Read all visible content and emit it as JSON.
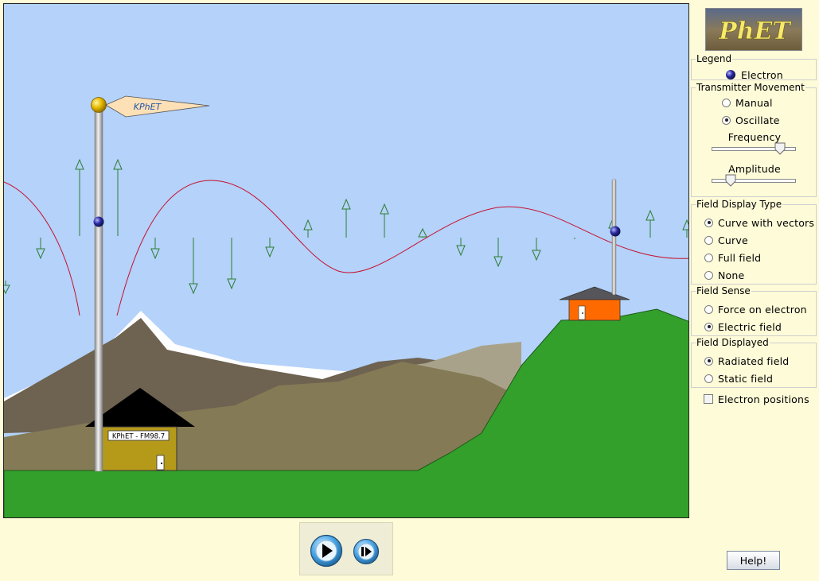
{
  "logo": {
    "text": "PhET"
  },
  "flag": {
    "text": "KPhET"
  },
  "station_sign": "KPhET - FM98.7",
  "legend": {
    "title": "Legend",
    "electron_label": "Electron"
  },
  "transmitter_movement": {
    "title": "Transmitter Movement",
    "options": [
      "Manual",
      "Oscillate"
    ],
    "selected": "Oscillate",
    "frequency_label": "Frequency",
    "frequency_value": 0.82,
    "amplitude_label": "Amplitude",
    "amplitude_value": 0.22
  },
  "field_display_type": {
    "title": "Field Display Type",
    "options": [
      "Curve with vectors",
      "Curve",
      "Full field",
      "None"
    ],
    "selected": "Curve with vectors"
  },
  "field_sense": {
    "title": "Field Sense",
    "options": [
      "Force on electron",
      "Electric field"
    ],
    "selected": "Electric field"
  },
  "field_displayed": {
    "title": "Field Displayed",
    "options": [
      "Radiated field",
      "Static field"
    ],
    "selected": "Radiated field"
  },
  "electron_positions": {
    "label": "Electron positions",
    "checked": false
  },
  "help_label": "Help!",
  "colors": {
    "sky": "#b4d2fa",
    "panel": "#fefbd8",
    "ground": "#33a02c",
    "wave": "#c8102e",
    "vector": "#2e7d32",
    "house_right": "#ff6a00",
    "house_left": "#b59a1a"
  }
}
